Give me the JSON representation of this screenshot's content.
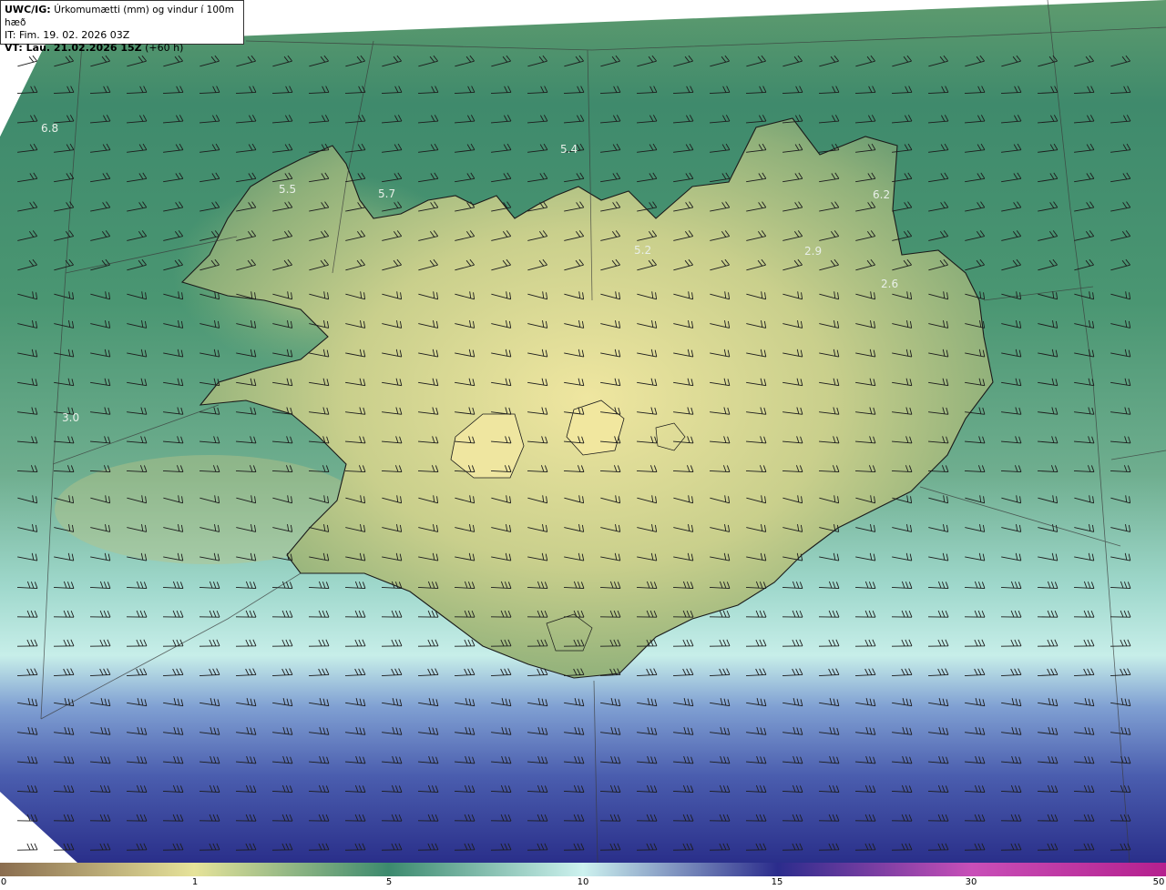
{
  "title_box": {
    "line1_bold": "UWC/IG:",
    "line1_rest": "Úrkomumætti (mm) og vindur í 100m hæð",
    "line2": "IT: Fim. 19. 02. 2026 03Z",
    "line3_bold": "VT: Lau. 21.02.2026 15Z",
    "line3_rest": "(+60 h)"
  },
  "map_labels": [
    "6.8",
    "5.4",
    "5.5",
    "5.7",
    "6.2",
    "5.2",
    "2.9",
    "2.6",
    "3.0"
  ],
  "legend": {
    "ticks": [
      "0",
      "1",
      "5",
      "10",
      "15",
      "30",
      "50"
    ],
    "colors": {
      "0": "#8a6d4f",
      "1": "#e6e39a",
      "5": "#3c8a6e",
      "10": "#cdf2ef",
      "15": "#2b2c8c",
      "30": "#c84fb8",
      "50": "#b5208e"
    }
  }
}
